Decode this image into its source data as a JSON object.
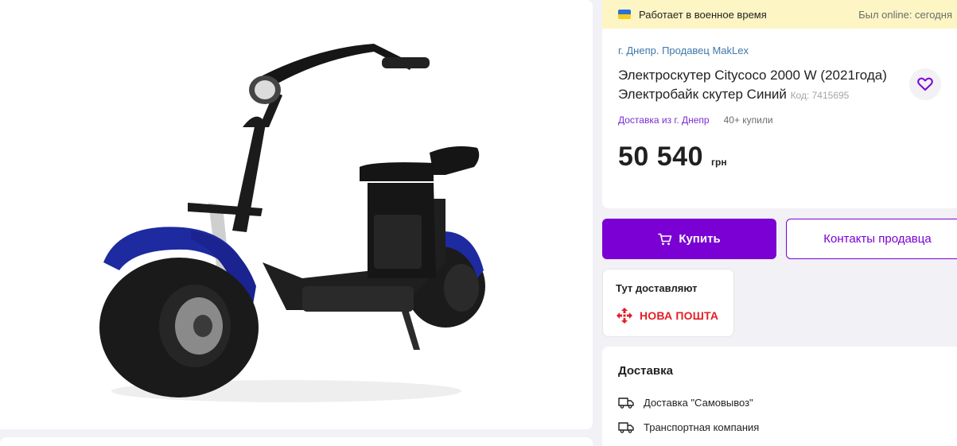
{
  "status_banner": {
    "left_text": "Работает в военное время",
    "right_text": "Был online: сегодня",
    "flag_colors": [
      "#2f6fd6",
      "#f5cd19"
    ]
  },
  "product": {
    "breadcrumb": "г. Днепр. Продавец MakLex",
    "title": "Электроскутер Citycoco 2000 W (2021года) Электробайк скутер Синий",
    "code": "Код: 7415695",
    "delivery_from": "Доставка из г. Днепр",
    "buyers": "40+ купили",
    "price": "50 540",
    "currency": "грн",
    "image_icon": "electric-scooter-photo"
  },
  "actions": {
    "buy_label": "Купить",
    "contacts_label": "Контакты продавца",
    "accent_color": "#7b00d3"
  },
  "delivery_here": {
    "title": "Тут доставляют",
    "carrier": "НОВА ПОШТА",
    "carrier_color": "#e41e26"
  },
  "delivery": {
    "title": "Доставка",
    "options": [
      {
        "label": "Доставка \"Самовывоз\"",
        "icon": "truck-icon"
      },
      {
        "label": "Транспортная компания",
        "icon": "truck-icon"
      }
    ]
  }
}
